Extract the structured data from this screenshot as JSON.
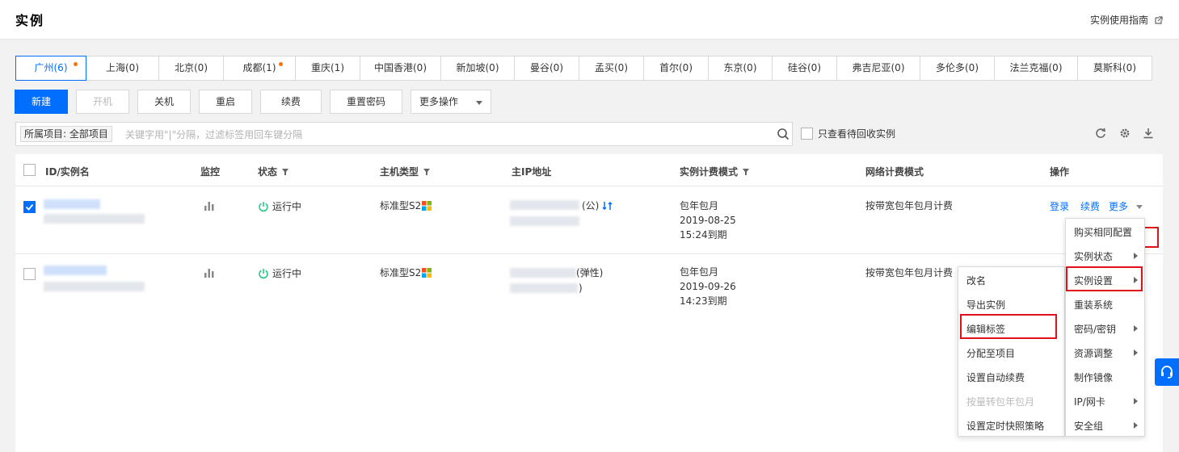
{
  "header": {
    "title": "实例",
    "guide_link": "实例使用指南",
    "guide_icon": "external-link-icon"
  },
  "regions": [
    {
      "label": "广州(6)",
      "active": true,
      "dot": true,
      "width": 88
    },
    {
      "label": "上海(0)",
      "width": 90
    },
    {
      "label": "北京(0)",
      "width": 80
    },
    {
      "label": "成都(1)",
      "dot": true,
      "width": 89
    },
    {
      "label": "重庆(1)",
      "width": 80
    },
    {
      "label": "中国香港(0)",
      "width": 100
    },
    {
      "label": "新加坡(0)",
      "width": 91
    },
    {
      "label": "曼谷(0)",
      "width": 80
    },
    {
      "label": "孟买(0)",
      "width": 80
    },
    {
      "label": "首尔(0)",
      "width": 80
    },
    {
      "label": "东京(0)",
      "width": 79
    },
    {
      "label": "硅谷(0)",
      "width": 80
    },
    {
      "label": "弗吉尼亚(0)",
      "width": 103
    },
    {
      "label": "多伦多(0)",
      "width": 92
    },
    {
      "label": "法兰克福(0)",
      "width": 103
    },
    {
      "label": "莫斯科(0)",
      "width": 92
    }
  ],
  "actions": {
    "new": "新建",
    "start": "开机",
    "shutdown": "关机",
    "restart": "重启",
    "renew": "续费",
    "reset_password": "重置密码",
    "more_ops": "更多操作"
  },
  "search": {
    "project_tag": "所属项目: 全部项目",
    "placeholder": "关键字用\"|\"分隔，过滤标签用回车键分隔",
    "recycle_label": "只查看待回收实例"
  },
  "table": {
    "headers": {
      "id": "ID/实例名",
      "monitor": "监控",
      "status": "状态",
      "host_type": "主机类型",
      "ip": "主IP地址",
      "billing": "实例计费模式",
      "net_billing": "网络计费模式",
      "ops": "操作"
    },
    "rows": [
      {
        "checked": true,
        "status": "运行中",
        "host_type": "标准型S2",
        "ip_suffix": "(公)",
        "billing": "包年包月",
        "date": "2019-08-25",
        "expire": "15:24到期",
        "net_billing": "按带宽包年包月计费",
        "ops": [
          "登录",
          "续费",
          "更多"
        ]
      },
      {
        "checked": false,
        "status": "运行中",
        "host_type": "标准型S2",
        "ip_suffix": "(弹性)",
        "ip_line2_suffix": ")",
        "billing": "包年包月",
        "date": "2019-09-26",
        "expire": "14:23到期",
        "net_billing": "按带宽包年包月计费"
      }
    ]
  },
  "more_menu": {
    "items": [
      {
        "label": "购买相同配置"
      },
      {
        "label": "实例状态",
        "submenu": true
      },
      {
        "label": "实例设置",
        "submenu": true
      },
      {
        "label": "重装系统"
      },
      {
        "label": "密码/密钥",
        "submenu": true
      },
      {
        "label": "资源调整",
        "submenu": true
      },
      {
        "label": "制作镜像"
      },
      {
        "label": "IP/网卡",
        "submenu": true
      },
      {
        "label": "安全组",
        "submenu": true
      }
    ]
  },
  "settings_menu": {
    "items": [
      {
        "label": "改名"
      },
      {
        "label": "导出实例"
      },
      {
        "label": "编辑标签"
      },
      {
        "label": "分配至项目"
      },
      {
        "label": "设置自动续费"
      },
      {
        "label": "按量转包年包月",
        "disabled": true
      },
      {
        "label": "设置定时快照策略"
      }
    ]
  },
  "colors": {
    "accent": "#006eff",
    "highlight": "#e1101a",
    "running": "#29cc85",
    "dot": "#ff7200"
  }
}
